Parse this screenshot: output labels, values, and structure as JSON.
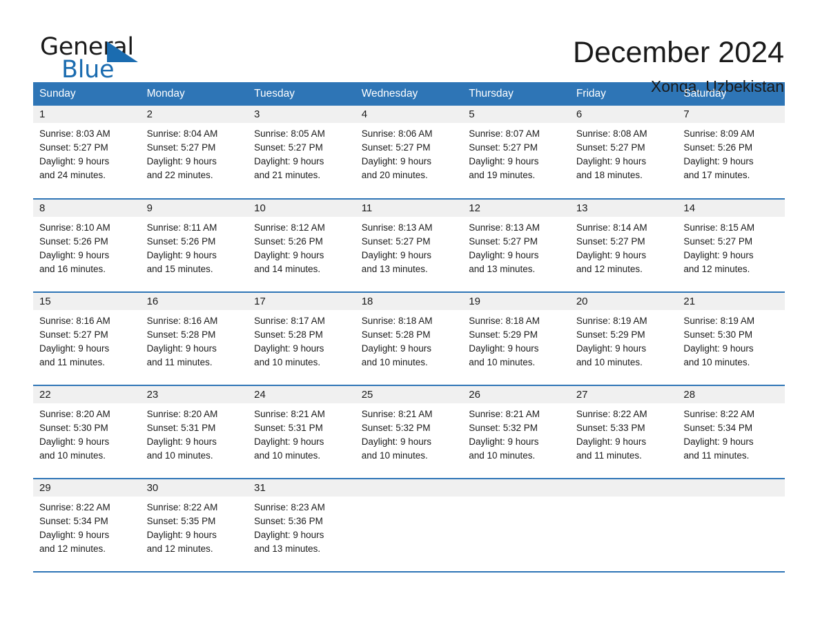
{
  "brand": {
    "word_one": "General",
    "word_two": "Blue",
    "triangle_icon": "triangle-logo-icon",
    "accent_color": "#1b6cb0"
  },
  "header": {
    "month_title": "December 2024",
    "location": "Xonqa, Uzbekistan"
  },
  "theme": {
    "header_bg": "#2e75b6",
    "header_text": "#ffffff",
    "daynum_band_bg": "#f0f0f0",
    "cell_bg": "#ffffff",
    "body_text": "#1a1a1a"
  },
  "calendar": {
    "weekday_headers": [
      "Sunday",
      "Monday",
      "Tuesday",
      "Wednesday",
      "Thursday",
      "Friday",
      "Saturday"
    ],
    "weeks": [
      [
        {
          "day": "1",
          "sunrise": "Sunrise: 8:03 AM",
          "sunset": "Sunset: 5:27 PM",
          "daylight_1": "Daylight: 9 hours",
          "daylight_2": "and 24 minutes."
        },
        {
          "day": "2",
          "sunrise": "Sunrise: 8:04 AM",
          "sunset": "Sunset: 5:27 PM",
          "daylight_1": "Daylight: 9 hours",
          "daylight_2": "and 22 minutes."
        },
        {
          "day": "3",
          "sunrise": "Sunrise: 8:05 AM",
          "sunset": "Sunset: 5:27 PM",
          "daylight_1": "Daylight: 9 hours",
          "daylight_2": "and 21 minutes."
        },
        {
          "day": "4",
          "sunrise": "Sunrise: 8:06 AM",
          "sunset": "Sunset: 5:27 PM",
          "daylight_1": "Daylight: 9 hours",
          "daylight_2": "and 20 minutes."
        },
        {
          "day": "5",
          "sunrise": "Sunrise: 8:07 AM",
          "sunset": "Sunset: 5:27 PM",
          "daylight_1": "Daylight: 9 hours",
          "daylight_2": "and 19 minutes."
        },
        {
          "day": "6",
          "sunrise": "Sunrise: 8:08 AM",
          "sunset": "Sunset: 5:27 PM",
          "daylight_1": "Daylight: 9 hours",
          "daylight_2": "and 18 minutes."
        },
        {
          "day": "7",
          "sunrise": "Sunrise: 8:09 AM",
          "sunset": "Sunset: 5:26 PM",
          "daylight_1": "Daylight: 9 hours",
          "daylight_2": "and 17 minutes."
        }
      ],
      [
        {
          "day": "8",
          "sunrise": "Sunrise: 8:10 AM",
          "sunset": "Sunset: 5:26 PM",
          "daylight_1": "Daylight: 9 hours",
          "daylight_2": "and 16 minutes."
        },
        {
          "day": "9",
          "sunrise": "Sunrise: 8:11 AM",
          "sunset": "Sunset: 5:26 PM",
          "daylight_1": "Daylight: 9 hours",
          "daylight_2": "and 15 minutes."
        },
        {
          "day": "10",
          "sunrise": "Sunrise: 8:12 AM",
          "sunset": "Sunset: 5:26 PM",
          "daylight_1": "Daylight: 9 hours",
          "daylight_2": "and 14 minutes."
        },
        {
          "day": "11",
          "sunrise": "Sunrise: 8:13 AM",
          "sunset": "Sunset: 5:27 PM",
          "daylight_1": "Daylight: 9 hours",
          "daylight_2": "and 13 minutes."
        },
        {
          "day": "12",
          "sunrise": "Sunrise: 8:13 AM",
          "sunset": "Sunset: 5:27 PM",
          "daylight_1": "Daylight: 9 hours",
          "daylight_2": "and 13 minutes."
        },
        {
          "day": "13",
          "sunrise": "Sunrise: 8:14 AM",
          "sunset": "Sunset: 5:27 PM",
          "daylight_1": "Daylight: 9 hours",
          "daylight_2": "and 12 minutes."
        },
        {
          "day": "14",
          "sunrise": "Sunrise: 8:15 AM",
          "sunset": "Sunset: 5:27 PM",
          "daylight_1": "Daylight: 9 hours",
          "daylight_2": "and 12 minutes."
        }
      ],
      [
        {
          "day": "15",
          "sunrise": "Sunrise: 8:16 AM",
          "sunset": "Sunset: 5:27 PM",
          "daylight_1": "Daylight: 9 hours",
          "daylight_2": "and 11 minutes."
        },
        {
          "day": "16",
          "sunrise": "Sunrise: 8:16 AM",
          "sunset": "Sunset: 5:28 PM",
          "daylight_1": "Daylight: 9 hours",
          "daylight_2": "and 11 minutes."
        },
        {
          "day": "17",
          "sunrise": "Sunrise: 8:17 AM",
          "sunset": "Sunset: 5:28 PM",
          "daylight_1": "Daylight: 9 hours",
          "daylight_2": "and 10 minutes."
        },
        {
          "day": "18",
          "sunrise": "Sunrise: 8:18 AM",
          "sunset": "Sunset: 5:28 PM",
          "daylight_1": "Daylight: 9 hours",
          "daylight_2": "and 10 minutes."
        },
        {
          "day": "19",
          "sunrise": "Sunrise: 8:18 AM",
          "sunset": "Sunset: 5:29 PM",
          "daylight_1": "Daylight: 9 hours",
          "daylight_2": "and 10 minutes."
        },
        {
          "day": "20",
          "sunrise": "Sunrise: 8:19 AM",
          "sunset": "Sunset: 5:29 PM",
          "daylight_1": "Daylight: 9 hours",
          "daylight_2": "and 10 minutes."
        },
        {
          "day": "21",
          "sunrise": "Sunrise: 8:19 AM",
          "sunset": "Sunset: 5:30 PM",
          "daylight_1": "Daylight: 9 hours",
          "daylight_2": "and 10 minutes."
        }
      ],
      [
        {
          "day": "22",
          "sunrise": "Sunrise: 8:20 AM",
          "sunset": "Sunset: 5:30 PM",
          "daylight_1": "Daylight: 9 hours",
          "daylight_2": "and 10 minutes."
        },
        {
          "day": "23",
          "sunrise": "Sunrise: 8:20 AM",
          "sunset": "Sunset: 5:31 PM",
          "daylight_1": "Daylight: 9 hours",
          "daylight_2": "and 10 minutes."
        },
        {
          "day": "24",
          "sunrise": "Sunrise: 8:21 AM",
          "sunset": "Sunset: 5:31 PM",
          "daylight_1": "Daylight: 9 hours",
          "daylight_2": "and 10 minutes."
        },
        {
          "day": "25",
          "sunrise": "Sunrise: 8:21 AM",
          "sunset": "Sunset: 5:32 PM",
          "daylight_1": "Daylight: 9 hours",
          "daylight_2": "and 10 minutes."
        },
        {
          "day": "26",
          "sunrise": "Sunrise: 8:21 AM",
          "sunset": "Sunset: 5:32 PM",
          "daylight_1": "Daylight: 9 hours",
          "daylight_2": "and 10 minutes."
        },
        {
          "day": "27",
          "sunrise": "Sunrise: 8:22 AM",
          "sunset": "Sunset: 5:33 PM",
          "daylight_1": "Daylight: 9 hours",
          "daylight_2": "and 11 minutes."
        },
        {
          "day": "28",
          "sunrise": "Sunrise: 8:22 AM",
          "sunset": "Sunset: 5:34 PM",
          "daylight_1": "Daylight: 9 hours",
          "daylight_2": "and 11 minutes."
        }
      ],
      [
        {
          "day": "29",
          "sunrise": "Sunrise: 8:22 AM",
          "sunset": "Sunset: 5:34 PM",
          "daylight_1": "Daylight: 9 hours",
          "daylight_2": "and 12 minutes."
        },
        {
          "day": "30",
          "sunrise": "Sunrise: 8:22 AM",
          "sunset": "Sunset: 5:35 PM",
          "daylight_1": "Daylight: 9 hours",
          "daylight_2": "and 12 minutes."
        },
        {
          "day": "31",
          "sunrise": "Sunrise: 8:23 AM",
          "sunset": "Sunset: 5:36 PM",
          "daylight_1": "Daylight: 9 hours",
          "daylight_2": "and 13 minutes."
        },
        {
          "day": "",
          "sunrise": "",
          "sunset": "",
          "daylight_1": "",
          "daylight_2": ""
        },
        {
          "day": "",
          "sunrise": "",
          "sunset": "",
          "daylight_1": "",
          "daylight_2": ""
        },
        {
          "day": "",
          "sunrise": "",
          "sunset": "",
          "daylight_1": "",
          "daylight_2": ""
        },
        {
          "day": "",
          "sunrise": "",
          "sunset": "",
          "daylight_1": "",
          "daylight_2": ""
        }
      ]
    ]
  }
}
